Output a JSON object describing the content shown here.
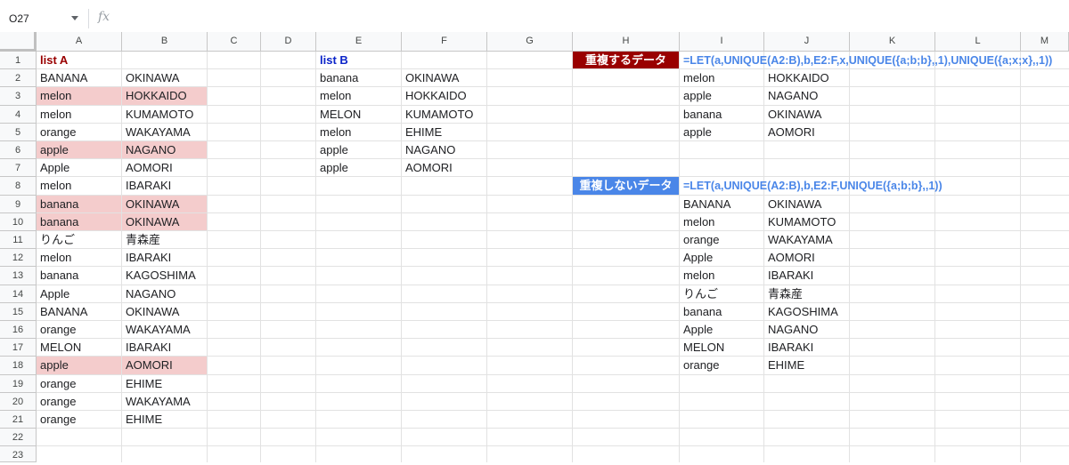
{
  "formula_bar": {
    "name_box": "O27",
    "fx_label": "fx"
  },
  "columns": [
    "A",
    "B",
    "C",
    "D",
    "E",
    "F",
    "G",
    "H",
    "I",
    "J",
    "K",
    "L",
    "M"
  ],
  "rows": [
    "1",
    "2",
    "3",
    "4",
    "5",
    "6",
    "7",
    "8",
    "9",
    "10",
    "11",
    "12",
    "13",
    "14",
    "15",
    "16",
    "17",
    "18",
    "19",
    "20",
    "21",
    "22",
    "23"
  ],
  "list_a": {
    "title": "list A",
    "rows": [
      {
        "a": "BANANA",
        "b": "OKINAWA",
        "highlight": false
      },
      {
        "a": "melon",
        "b": "HOKKAIDO",
        "highlight": true
      },
      {
        "a": "melon",
        "b": "KUMAMOTO",
        "highlight": false
      },
      {
        "a": "orange",
        "b": "WAKAYAMA",
        "highlight": false
      },
      {
        "a": "apple",
        "b": "NAGANO",
        "highlight": true
      },
      {
        "a": "Apple",
        "b": "AOMORI",
        "highlight": false
      },
      {
        "a": "melon",
        "b": "IBARAKI",
        "highlight": false
      },
      {
        "a": "banana",
        "b": "OKINAWA",
        "highlight": true
      },
      {
        "a": "banana",
        "b": "OKINAWA",
        "highlight": true
      },
      {
        "a": "りんご",
        "b": "青森産",
        "highlight": false
      },
      {
        "a": "melon",
        "b": "IBARAKI",
        "highlight": false
      },
      {
        "a": "banana",
        "b": "KAGOSHIMA",
        "highlight": false
      },
      {
        "a": "Apple",
        "b": "NAGANO",
        "highlight": false
      },
      {
        "a": "BANANA",
        "b": "OKINAWA",
        "highlight": false
      },
      {
        "a": "orange",
        "b": "WAKAYAMA",
        "highlight": false
      },
      {
        "a": "MELON",
        "b": "IBARAKI",
        "highlight": false
      },
      {
        "a": "apple",
        "b": "AOMORI",
        "highlight": true
      },
      {
        "a": "orange",
        "b": "EHIME",
        "highlight": false
      },
      {
        "a": "orange",
        "b": "WAKAYAMA",
        "highlight": false
      },
      {
        "a": "orange",
        "b": "EHIME",
        "highlight": false
      }
    ]
  },
  "list_b": {
    "title": "list B",
    "rows": [
      {
        "e": "banana",
        "f": "OKINAWA"
      },
      {
        "e": "melon",
        "f": "HOKKAIDO"
      },
      {
        "e": "MELON",
        "f": "KUMAMOTO"
      },
      {
        "e": "melon",
        "f": "EHIME"
      },
      {
        "e": "apple",
        "f": "NAGANO"
      },
      {
        "e": "apple",
        "f": "AOMORI"
      }
    ]
  },
  "duplicates": {
    "label": "重複するデータ",
    "formula": "=LET(a,UNIQUE(A2:B),b,E2:F,x,UNIQUE({a;b;b},,1),UNIQUE({a;x;x},,1))",
    "rows": [
      {
        "i": "melon",
        "j": "HOKKAIDO"
      },
      {
        "i": "apple",
        "j": "NAGANO"
      },
      {
        "i": "banana",
        "j": "OKINAWA"
      },
      {
        "i": "apple",
        "j": "AOMORI"
      }
    ]
  },
  "non_duplicates": {
    "label": "重複しないデータ",
    "formula": "=LET(a,UNIQUE(A2:B),b,E2:F,UNIQUE({a;b;b},,1))",
    "rows": [
      {
        "i": "BANANA",
        "j": "OKINAWA"
      },
      {
        "i": "melon",
        "j": "KUMAMOTO"
      },
      {
        "i": "orange",
        "j": "WAKAYAMA"
      },
      {
        "i": "Apple",
        "j": "AOMORI"
      },
      {
        "i": "melon",
        "j": "IBARAKI"
      },
      {
        "i": "りんご",
        "j": "青森産"
      },
      {
        "i": "banana",
        "j": "KAGOSHIMA"
      },
      {
        "i": "Apple",
        "j": "NAGANO"
      },
      {
        "i": "MELON",
        "j": "IBARAKI"
      },
      {
        "i": "orange",
        "j": "EHIME"
      }
    ]
  },
  "colors": {
    "highlight": "#f4cccc",
    "dup_label_bg": "#990000",
    "nondup_label_bg": "#4a86e8",
    "formula_text": "#4a86e8",
    "list_a_title": "#990000",
    "list_b_title": "#0b24c9"
  }
}
